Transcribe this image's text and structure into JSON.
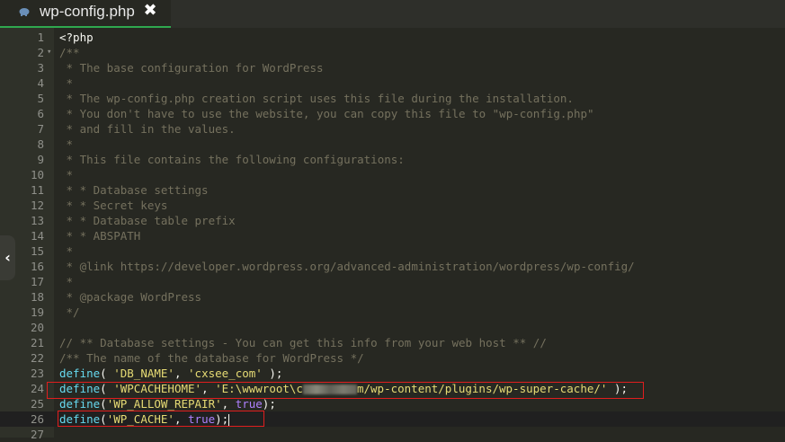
{
  "tab": {
    "title": "wp-config.php",
    "close_label": "✖",
    "icon": "php-elephant-icon"
  },
  "side_handle": {
    "label": "‹",
    "icon": "chevron-left-icon"
  },
  "lines": [
    {
      "n": "1",
      "segments": [
        {
          "t": "<?php",
          "c": "c-tag"
        }
      ]
    },
    {
      "n": "2",
      "fold": "▾",
      "segments": [
        {
          "t": "/**",
          "c": "c-cm"
        }
      ]
    },
    {
      "n": "3",
      "segments": [
        {
          "t": " * The base configuration for WordPress",
          "c": "c-cm"
        }
      ]
    },
    {
      "n": "4",
      "segments": [
        {
          "t": " *",
          "c": "c-cm"
        }
      ]
    },
    {
      "n": "5",
      "segments": [
        {
          "t": " * The wp-config.php creation script uses this file during the installation.",
          "c": "c-cm"
        }
      ]
    },
    {
      "n": "6",
      "segments": [
        {
          "t": " * You don't have to use the website, you can copy this file to \"wp-config.php\"",
          "c": "c-cm"
        }
      ]
    },
    {
      "n": "7",
      "segments": [
        {
          "t": " * and fill in the values.",
          "c": "c-cm"
        }
      ]
    },
    {
      "n": "8",
      "segments": [
        {
          "t": " *",
          "c": "c-cm"
        }
      ]
    },
    {
      "n": "9",
      "segments": [
        {
          "t": " * This file contains the following configurations:",
          "c": "c-cm"
        }
      ]
    },
    {
      "n": "10",
      "segments": [
        {
          "t": " *",
          "c": "c-cm"
        }
      ]
    },
    {
      "n": "11",
      "segments": [
        {
          "t": " * * Database settings",
          "c": "c-cm"
        }
      ]
    },
    {
      "n": "12",
      "segments": [
        {
          "t": " * * Secret keys",
          "c": "c-cm"
        }
      ]
    },
    {
      "n": "13",
      "segments": [
        {
          "t": " * * Database table prefix",
          "c": "c-cm"
        }
      ]
    },
    {
      "n": "14",
      "segments": [
        {
          "t": " * * ABSPATH",
          "c": "c-cm"
        }
      ]
    },
    {
      "n": "15",
      "segments": [
        {
          "t": " *",
          "c": "c-cm"
        }
      ]
    },
    {
      "n": "16",
      "segments": [
        {
          "t": " * @link https://developer.wordpress.org/advanced-administration/wordpress/wp-config/",
          "c": "c-cm"
        }
      ]
    },
    {
      "n": "17",
      "segments": [
        {
          "t": " *",
          "c": "c-cm"
        }
      ]
    },
    {
      "n": "18",
      "segments": [
        {
          "t": " * @package WordPress",
          "c": "c-cm"
        }
      ]
    },
    {
      "n": "19",
      "segments": [
        {
          "t": " */",
          "c": "c-cm"
        }
      ]
    },
    {
      "n": "20",
      "segments": []
    },
    {
      "n": "21",
      "segments": [
        {
          "t": "// ** Database settings - You can get this info from your web host ** //",
          "c": "c-cm"
        }
      ]
    },
    {
      "n": "22",
      "segments": [
        {
          "t": "/** The name of the database for WordPress */",
          "c": "c-cm"
        }
      ]
    },
    {
      "n": "23",
      "segments": [
        {
          "t": "define",
          "c": "c-fn"
        },
        {
          "t": "( ",
          "c": "c-pl"
        },
        {
          "t": "'DB_NAME'",
          "c": "c-str"
        },
        {
          "t": ", ",
          "c": "c-pl"
        },
        {
          "t": "'cxsee_com'",
          "c": "c-str"
        },
        {
          "t": " );",
          "c": "c-pl"
        }
      ]
    },
    {
      "n": "24",
      "segments": [
        {
          "t": "define",
          "c": "c-fn"
        },
        {
          "t": "( ",
          "c": "c-pl"
        },
        {
          "t": "'WPCACHEHOME'",
          "c": "c-str"
        },
        {
          "t": ", ",
          "c": "c-pl"
        },
        {
          "t": "'E:\\wwwroot\\c",
          "c": "c-str"
        },
        {
          "blur": true
        },
        {
          "t": "m/wp-content/plugins/wp-super-cache/'",
          "c": "c-str"
        },
        {
          "t": " );",
          "c": "c-pl"
        }
      ]
    },
    {
      "n": "25",
      "segments": [
        {
          "t": "define",
          "c": "c-fn"
        },
        {
          "t": "(",
          "c": "c-pl"
        },
        {
          "t": "'WP_ALLOW_REPAIR'",
          "c": "c-str"
        },
        {
          "t": ", ",
          "c": "c-pl"
        },
        {
          "t": "true",
          "c": "c-kw"
        },
        {
          "t": ");",
          "c": "c-pl"
        }
      ]
    },
    {
      "n": "26",
      "active": true,
      "segments": [
        {
          "t": "define",
          "c": "c-fn"
        },
        {
          "t": "(",
          "c": "c-pl"
        },
        {
          "t": "'WP_CACHE'",
          "c": "c-str"
        },
        {
          "t": ", ",
          "c": "c-pl"
        },
        {
          "t": "true",
          "c": "c-kw"
        },
        {
          "t": ");",
          "c": "c-pl"
        },
        {
          "cursor": true
        }
      ]
    },
    {
      "n": "27",
      "segments": []
    }
  ]
}
